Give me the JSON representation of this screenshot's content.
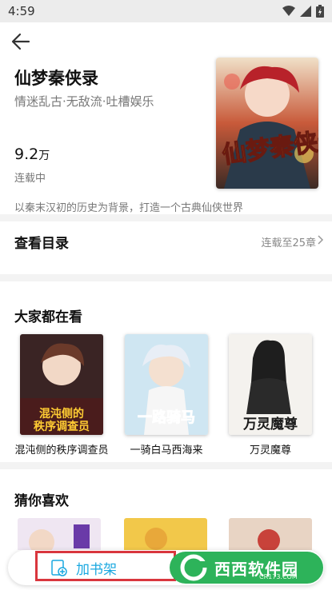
{
  "status_bar": {
    "time": "4:59"
  },
  "book": {
    "title": "仙梦秦侠录",
    "tags": "情迷乱古·无敌流·吐槽娱乐",
    "rating_value": "9.2",
    "rating_unit": "万",
    "status": "连载中",
    "synopsis": "以秦末汉初的历史为背景，打造一个古典仙侠世界",
    "cover_text": "仙梦秦侠录"
  },
  "catalog": {
    "title": "查看目录",
    "progress": "连载至25章"
  },
  "recommend": {
    "title": "大家都在看",
    "items": [
      {
        "name": "混沌侧的秩序调查员",
        "cover_text": "混沌侧的秩序调查员"
      },
      {
        "name": "一骑白马西海来",
        "cover_text": "一路骑马"
      },
      {
        "name": "万灵魔尊",
        "cover_text": "万灵魔尊"
      }
    ]
  },
  "guess": {
    "title": "猜你喜欢"
  },
  "bottom": {
    "add_shelf_label": "加书架",
    "watermark": "西西软件园",
    "watermark_sub": "CR173.COM"
  },
  "colors": {
    "accent_blue": "#1aa8e0",
    "highlight_red": "#d9363e",
    "green": "#2db35a"
  }
}
